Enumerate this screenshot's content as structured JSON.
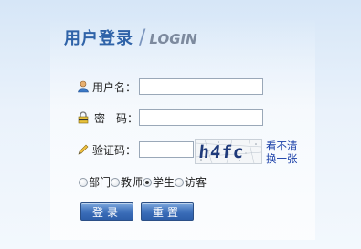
{
  "header": {
    "title_cn": "用户登录",
    "separator": "/",
    "title_en": "LOGIN"
  },
  "form": {
    "username_label": "用户名：",
    "username_value": "",
    "password_label": "密　码：",
    "password_value": "",
    "captcha_label": "验证码：",
    "captcha_value": "",
    "captcha_text": "h4fc",
    "refresh_line1": "看不清",
    "refresh_line2": "换一张"
  },
  "roles": [
    {
      "label": "部门",
      "checked": false
    },
    {
      "label": "教师",
      "checked": false
    },
    {
      "label": "学生",
      "checked": true
    },
    {
      "label": "访客",
      "checked": false
    }
  ],
  "buttons": {
    "login": "登录",
    "reset": "重置"
  },
  "colors": {
    "title": "#2f63a8",
    "button": "#3c6fba",
    "link": "#1a3fa8"
  }
}
